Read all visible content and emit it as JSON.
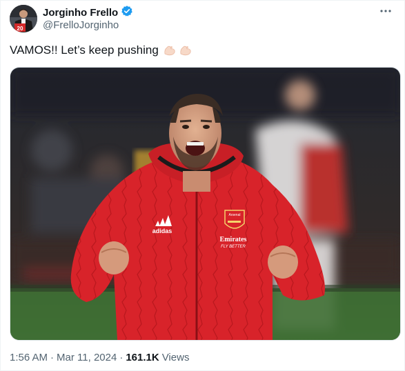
{
  "author": {
    "name": "Jorginho Frello",
    "handle": "@FrelloJorginho",
    "verified": true,
    "avatar_jersey_number": "20"
  },
  "tweet": {
    "text": "VAMOS!! Let’s keep pushing",
    "emoji": [
      "flexed-biceps",
      "flexed-biceps"
    ]
  },
  "media": {
    "jacket_brand": "adidas",
    "crest_text": "Arsenal",
    "sponsor": "Emirates",
    "sponsor_tagline": "FLY BETTER"
  },
  "meta": {
    "time": "1:56 AM",
    "separator": "·",
    "date": "Mar 11, 2024",
    "views_count": "161.1K",
    "views_label": "Views"
  },
  "colors": {
    "verified_blue": "#1d9bf0",
    "secondary_text": "#536471",
    "jacket_red": "#d8232a"
  },
  "icons": {
    "verified": "verified-badge-icon",
    "more": "more-options-icon"
  }
}
